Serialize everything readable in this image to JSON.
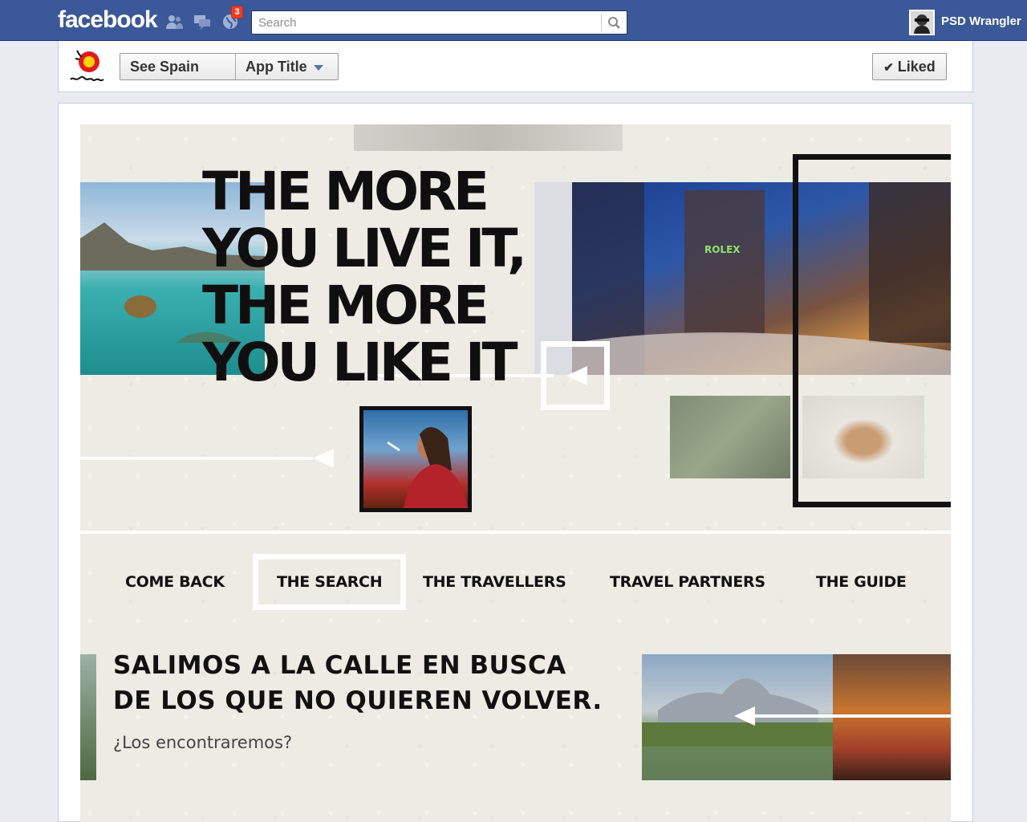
{
  "facebook": {
    "logo": "facebook",
    "notifications_count": "3",
    "search_placeholder": "Search",
    "profile_name": "PSD Wrangler"
  },
  "page_header": {
    "nav_page": "See Spain",
    "nav_app": "App Title",
    "liked_label": "Liked"
  },
  "app": {
    "headline_lines": [
      "THE MORE",
      "YOU LIVE IT,",
      "THE MORE",
      "YOU LIKE IT"
    ],
    "menu": [
      "COME BACK",
      "THE SEARCH",
      "THE TRAVELLERS",
      "TRAVEL PARTNERS",
      "THE GUIDE"
    ],
    "active_menu": "THE SEARCH",
    "lead_lines": [
      "SALIMOS A LA CALLE EN BUSCA",
      "DE LOS QUE NO QUIEREN VOLVER."
    ],
    "sub": "¿Los encontraremos?"
  },
  "colors": {
    "facebook_blue": "#3b5998",
    "page_bg": "#e9ebf1",
    "app_bg": "#ecebe4",
    "notification_red": "#f03d25"
  }
}
